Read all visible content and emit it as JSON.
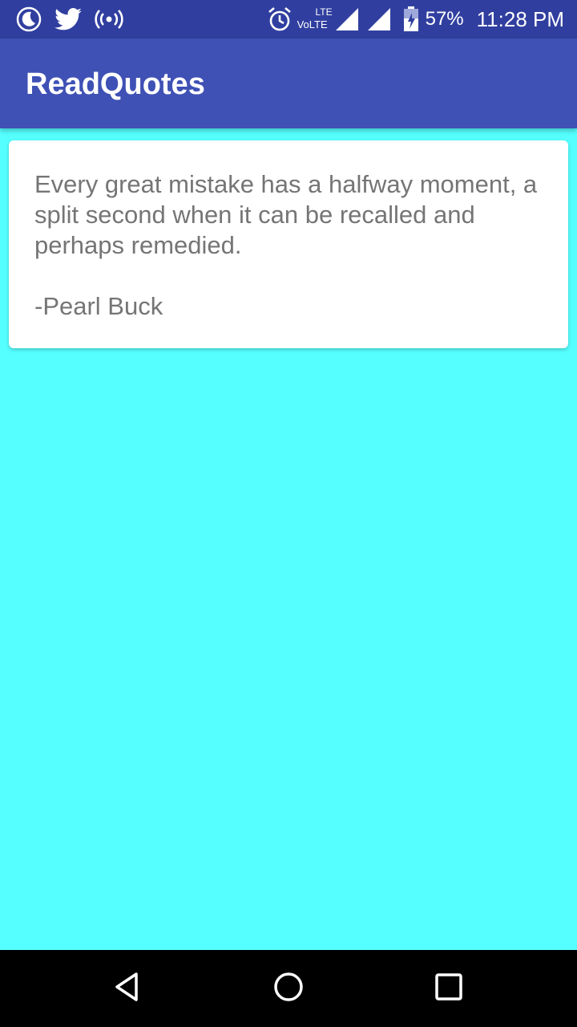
{
  "status_bar": {
    "left_icons": [
      "moon-icon",
      "twitter-icon",
      "hotspot-icon"
    ],
    "alarm_icon": "alarm-icon",
    "network_top": "LTE",
    "network_bottom": "VoLTE",
    "battery": "57%",
    "time": "11:28 PM"
  },
  "app_bar": {
    "title": "ReadQuotes"
  },
  "quote": {
    "text": "Every great mistake has a halfway moment, a split second when it can be recalled and perhaps remedied.",
    "author": "-Pearl Buck"
  },
  "nav": {
    "back": "back-icon",
    "home": "home-icon",
    "recents": "recents-icon"
  },
  "colors": {
    "status_bar": "#303F9F",
    "app_bar": "#3F51B5",
    "background": "#55FFFF",
    "card": "#FFFFFF",
    "text": "#757575"
  }
}
